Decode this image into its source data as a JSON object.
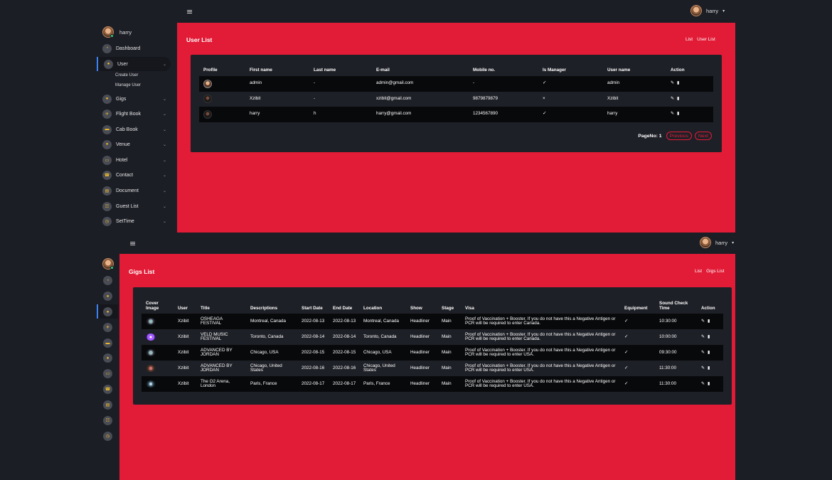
{
  "top": {
    "header": {
      "menu_glyph": "≡",
      "user": "harry"
    },
    "sidebar": {
      "username": "harry",
      "items": [
        {
          "label": "Dashboard",
          "icon": "dashboard-icon",
          "chev": ""
        },
        {
          "label": "User",
          "icon": "user-icon",
          "chev": "⌄"
        },
        {
          "label": "Gigs",
          "icon": "gigs-icon",
          "chev": "⌄"
        },
        {
          "label": "Flight Book",
          "icon": "plane-icon",
          "chev": "⌄"
        },
        {
          "label": "Cab Book",
          "icon": "car-icon",
          "chev": "⌄"
        },
        {
          "label": "Venue",
          "icon": "pin-icon",
          "chev": "⌄"
        },
        {
          "label": "Hotel",
          "icon": "hotel-icon",
          "chev": "⌄"
        },
        {
          "label": "Contact",
          "icon": "contact-icon",
          "chev": "⌄"
        },
        {
          "label": "Document",
          "icon": "document-icon",
          "chev": "⌄"
        },
        {
          "label": "Guest List",
          "icon": "guest-icon",
          "chev": "⌄"
        },
        {
          "label": "SetTime",
          "icon": "clock-icon",
          "chev": "⌄"
        }
      ],
      "sub_items": [
        "Create User",
        "Manage User"
      ]
    },
    "page_title": "User List",
    "breadcrumb": [
      "List",
      "User List"
    ],
    "table": {
      "headers": [
        "Profile",
        "First name",
        "Last name",
        "E-mail",
        "Mobile no.",
        "Is Manager",
        "User name",
        "Action"
      ],
      "rows": [
        {
          "first": "admin",
          "last": "-",
          "email": "admin@gmail.com",
          "mobile": "-",
          "manager": "✓",
          "username": "admin"
        },
        {
          "first": "Xzibit",
          "last": "-",
          "email": "xzibit@gmail.com",
          "mobile": "9879879879",
          "manager": "×",
          "username": "Xzibit"
        },
        {
          "first": "harry",
          "last": "h",
          "email": "harry@gmail.com",
          "mobile": "1234567890",
          "manager": "✓",
          "username": "harry"
        }
      ]
    },
    "pager": {
      "label": "PageNo: 1",
      "prev": "Previous",
      "next": "Next"
    }
  },
  "bottom": {
    "header": {
      "menu_glyph": "≡",
      "user": "harry"
    },
    "page_title": "Gigs List",
    "breadcrumb": [
      "List",
      "Gigs List"
    ],
    "table": {
      "headers": [
        "Cover Image",
        "User",
        "Title",
        "Descriptions",
        "Start Date",
        "End Date",
        "Location",
        "Show",
        "Stage",
        "Visa",
        "Equipment",
        "Sound Check Time",
        "Action"
      ],
      "rows": [
        {
          "user": "Xzibit",
          "title": "OSHEAGA FESTIVAL",
          "desc": "Montreal, Canada",
          "start": "2022-08-13",
          "end": "2022-08-13",
          "location": "Montreal, Canada",
          "show": "Headliner",
          "stage": "Main",
          "visa": "Proof of Vaccination + Booster. If you do not have this a Negative Antigen or PCR will be required to enter Canada.",
          "equipment": "✓",
          "time": "10:30:00"
        },
        {
          "user": "Xzibit",
          "title": "VELD MUSIC FESTIVAL",
          "desc": "Toronto, Canada",
          "start": "2022-08-14",
          "end": "2022-08-14",
          "location": "Toronto, Canada",
          "show": "Headliner",
          "stage": "Main",
          "visa": "Proof of Vaccination + Booster. If you do not have this a Negative Antigen or PCR will be required to enter Canada.",
          "equipment": "✓",
          "time": "10:00:00"
        },
        {
          "user": "Xzibit",
          "title": "ADVANCED BY JORDAN",
          "desc": "Chicago, USA",
          "start": "2022-08-15",
          "end": "2022-08-15",
          "location": "Chicago, USA",
          "show": "Headliner",
          "stage": "Main",
          "visa": "Proof of Vaccination + Booster. If you do not have this a Negative Antigen or PCR will be required to enter USA.",
          "equipment": "✓",
          "time": "09:30:00"
        },
        {
          "user": "Xzibit",
          "title": "ADVANCED BY JORDAN",
          "desc": "Chicago, United States",
          "start": "2022-08-16",
          "end": "2022-08-16",
          "location": "Chicago, United States",
          "show": "Headliner",
          "stage": "Main",
          "visa": "Proof of Vaccination + Booster. If you do not have this a Negative Antigen or PCR will be required to enter USA.",
          "equipment": "✓",
          "time": "11:30:00"
        },
        {
          "user": "Xzibit",
          "title": "The O2 Arena, London",
          "desc": "Paris, France",
          "start": "2022-08-17",
          "end": "2022-08-17",
          "location": "Paris, France",
          "show": "Headliner",
          "stage": "Main",
          "visa": "Proof of Vaccination + Booster. If you do not have this a Negative Antigen or PCR will be required to enter USA.",
          "equipment": "✓",
          "time": "11:30:00"
        }
      ]
    }
  },
  "colors": {
    "accent": "#e21b36",
    "background": "#1c1e26",
    "card": "#1e2027"
  }
}
